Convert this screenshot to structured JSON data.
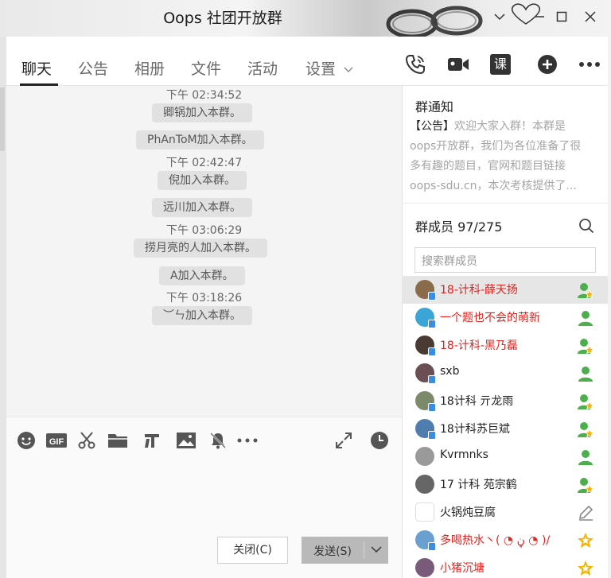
{
  "window": {
    "title": "Oops 社团开放群"
  },
  "tabs": [
    {
      "label": "聊天",
      "active": true
    },
    {
      "label": "公告"
    },
    {
      "label": "相册"
    },
    {
      "label": "文件"
    },
    {
      "label": "活动"
    },
    {
      "label": "设置"
    }
  ],
  "toolbar_icons": [
    "phone-icon",
    "video-icon",
    "lesson-icon",
    "add-icon",
    "more-icon"
  ],
  "lesson_label": "课",
  "messages": [
    {
      "type": "time",
      "text": "下午 02:34:52"
    },
    {
      "type": "system",
      "text": "卿锅加入本群。"
    },
    {
      "type": "system",
      "text": "PhAnToM加入本群。"
    },
    {
      "type": "time",
      "text": "下午 02:42:47"
    },
    {
      "type": "system",
      "text": "倪加入本群。"
    },
    {
      "type": "system",
      "text": "远川加入本群。"
    },
    {
      "type": "time",
      "text": "下午 03:06:29"
    },
    {
      "type": "system",
      "text": "捞月亮的人加入本群。"
    },
    {
      "type": "system",
      "text": "A加入本群。"
    },
    {
      "type": "time",
      "text": "下午 03:18:26"
    },
    {
      "type": "system",
      "text": "︶ㄣ加入本群。"
    }
  ],
  "input_tools": [
    "emoji-icon",
    "gif-icon",
    "scissors-icon",
    "folder-icon",
    "transfer-icon",
    "image-icon",
    "mute-bell-icon",
    "more-icon",
    "expand-icon",
    "history-clock-icon"
  ],
  "buttons": {
    "close": "关闭(C)",
    "send": "发送(S)"
  },
  "notice": {
    "title": "群通知",
    "tag": "【公告】",
    "text": "欢迎大家入群！本群是oops开放群，我们为各位准备了很多有趣的题目，官网和题目链接oops-sdu.cn，本次考核提供了..."
  },
  "members_header": {
    "label": "群成员",
    "count": "97/275"
  },
  "member_search": {
    "placeholder": "搜索群成员"
  },
  "members": [
    {
      "name": "18-计科-薛天扬",
      "red": true,
      "badge": "admin-star-icon",
      "selected": true,
      "avatar": "#8a6b4c",
      "mobile": true
    },
    {
      "name": "一个题也不会的萌新",
      "red": true,
      "badge": "member-icon",
      "avatar": "#3aa6d8",
      "mobile": true
    },
    {
      "name": "18-计科-黑乃磊",
      "red": true,
      "badge": "admin-star-icon",
      "avatar": "#4a3a34",
      "mobile": true
    },
    {
      "name": "sxb",
      "red": false,
      "badge": "member-icon",
      "avatar": "#6b4f55",
      "mobile": true
    },
    {
      "name": "18计科 亓龙雨",
      "red": false,
      "badge": "admin-star-icon",
      "avatar": "#7a8a6a",
      "mobile": true
    },
    {
      "name": "18计科苏巨斌",
      "red": false,
      "badge": "admin-star-icon",
      "avatar": "#4f7db0",
      "mobile": true
    },
    {
      "name": "Kvrmnks",
      "red": false,
      "badge": "member-icon",
      "avatar": "#9a9a9a",
      "mobile": false
    },
    {
      "name": "17 计科 苑宗鹤",
      "red": false,
      "badge": "admin-star-icon",
      "avatar": "#666",
      "mobile": false
    },
    {
      "name": "火锅炖豆腐",
      "red": false,
      "badge": "pencil-icon",
      "avatar": "#ffffff",
      "mobile": false
    },
    {
      "name": "多喝热水丶( ◔ ڼ ◔ )/",
      "red": true,
      "badge": "owner-star-icon",
      "avatar": "#6aa0d0",
      "mobile": true
    },
    {
      "name": "小猪沉塘",
      "red": true,
      "badge": "owner-star-icon",
      "avatar": "#7a5a7a",
      "mobile": false
    }
  ],
  "colors": {
    "red_name": "#e0231f",
    "mobile_badge": "#3b8de0",
    "admin_green": "#4cae4c",
    "owner_gold": "#f5b400"
  }
}
